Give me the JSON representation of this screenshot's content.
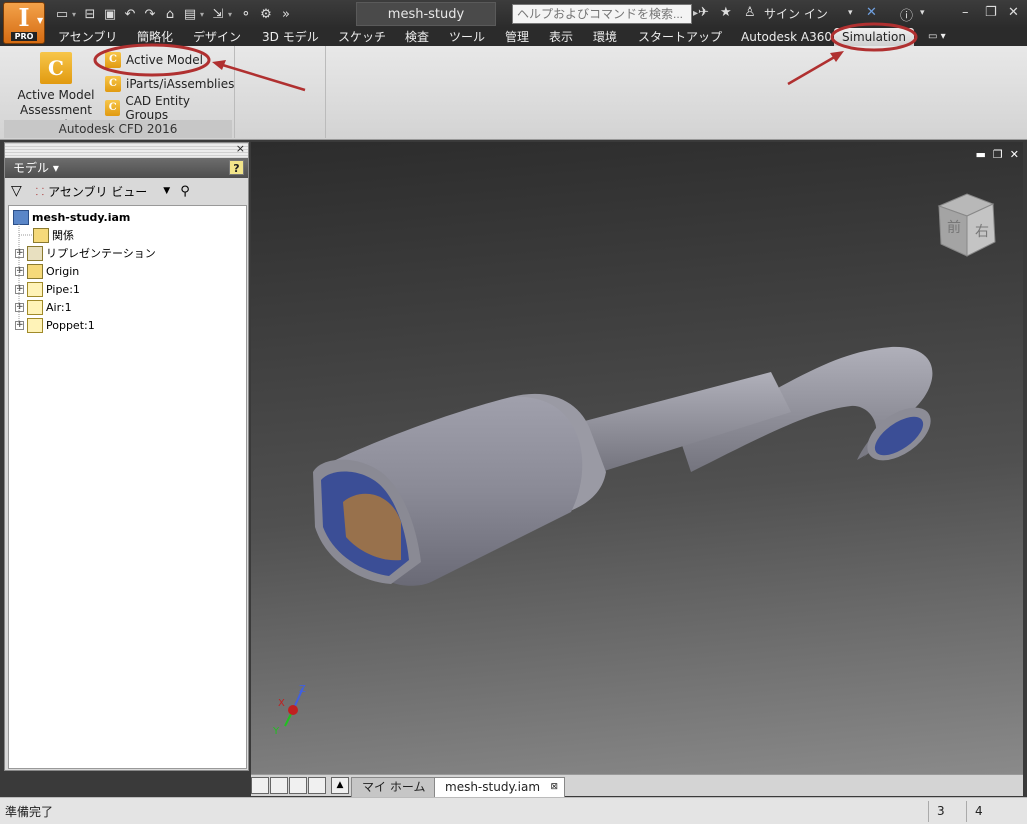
{
  "window": {
    "title": "mesh-study"
  },
  "search": {
    "placeholder": "ヘルプおよびコマンドを検索..."
  },
  "app_button": {
    "letter": "I",
    "badge": "PRO"
  },
  "account": {
    "signin_label": "サイン イン"
  },
  "ribbon_tabs": [
    {
      "label": "アセンブリ"
    },
    {
      "label": "簡略化"
    },
    {
      "label": "デザイン"
    },
    {
      "label": "3D モデル"
    },
    {
      "label": "スケッチ"
    },
    {
      "label": "検査"
    },
    {
      "label": "ツール"
    },
    {
      "label": "管理"
    },
    {
      "label": "表示"
    },
    {
      "label": "環境"
    },
    {
      "label": "スタートアップ"
    },
    {
      "label": "Autodesk A360"
    },
    {
      "label": "Simulation"
    }
  ],
  "ribbon_panel": {
    "title": "Autodesk CFD 2016",
    "large_button_label": "Active Model\nAssessment Tool",
    "small_buttons": [
      {
        "label": "Active Model"
      },
      {
        "label": "iParts/iAssemblies"
      },
      {
        "label": "CAD Entity Groups"
      }
    ],
    "logo_letter": "C"
  },
  "browser": {
    "title": "モデル ▾",
    "view_selector": "アセンブリ ビュー",
    "tree": [
      {
        "label": "mesh-study.iam",
        "bold": true
      },
      {
        "label": "関係"
      },
      {
        "label": "リプレゼンテーション"
      },
      {
        "label": "Origin"
      },
      {
        "label": "Pipe:1"
      },
      {
        "label": "Air:1"
      },
      {
        "label": "Poppet:1"
      }
    ]
  },
  "viewcube": {
    "face_labels": [
      "前",
      "右"
    ]
  },
  "triad": {
    "x": "X",
    "y": "Y",
    "z": "Z"
  },
  "doc_tabs": [
    {
      "label": "マイ ホーム",
      "active": false
    },
    {
      "label": "mesh-study.iam",
      "active": true
    }
  ],
  "status": {
    "text": "準備完了",
    "count1": "3",
    "count2": "4"
  },
  "colors": {
    "annotation_red": "#b03030",
    "app_orange": "#e07a1c",
    "model_gray": "#8a8a96",
    "model_inner_blue": "#3b4e96"
  }
}
